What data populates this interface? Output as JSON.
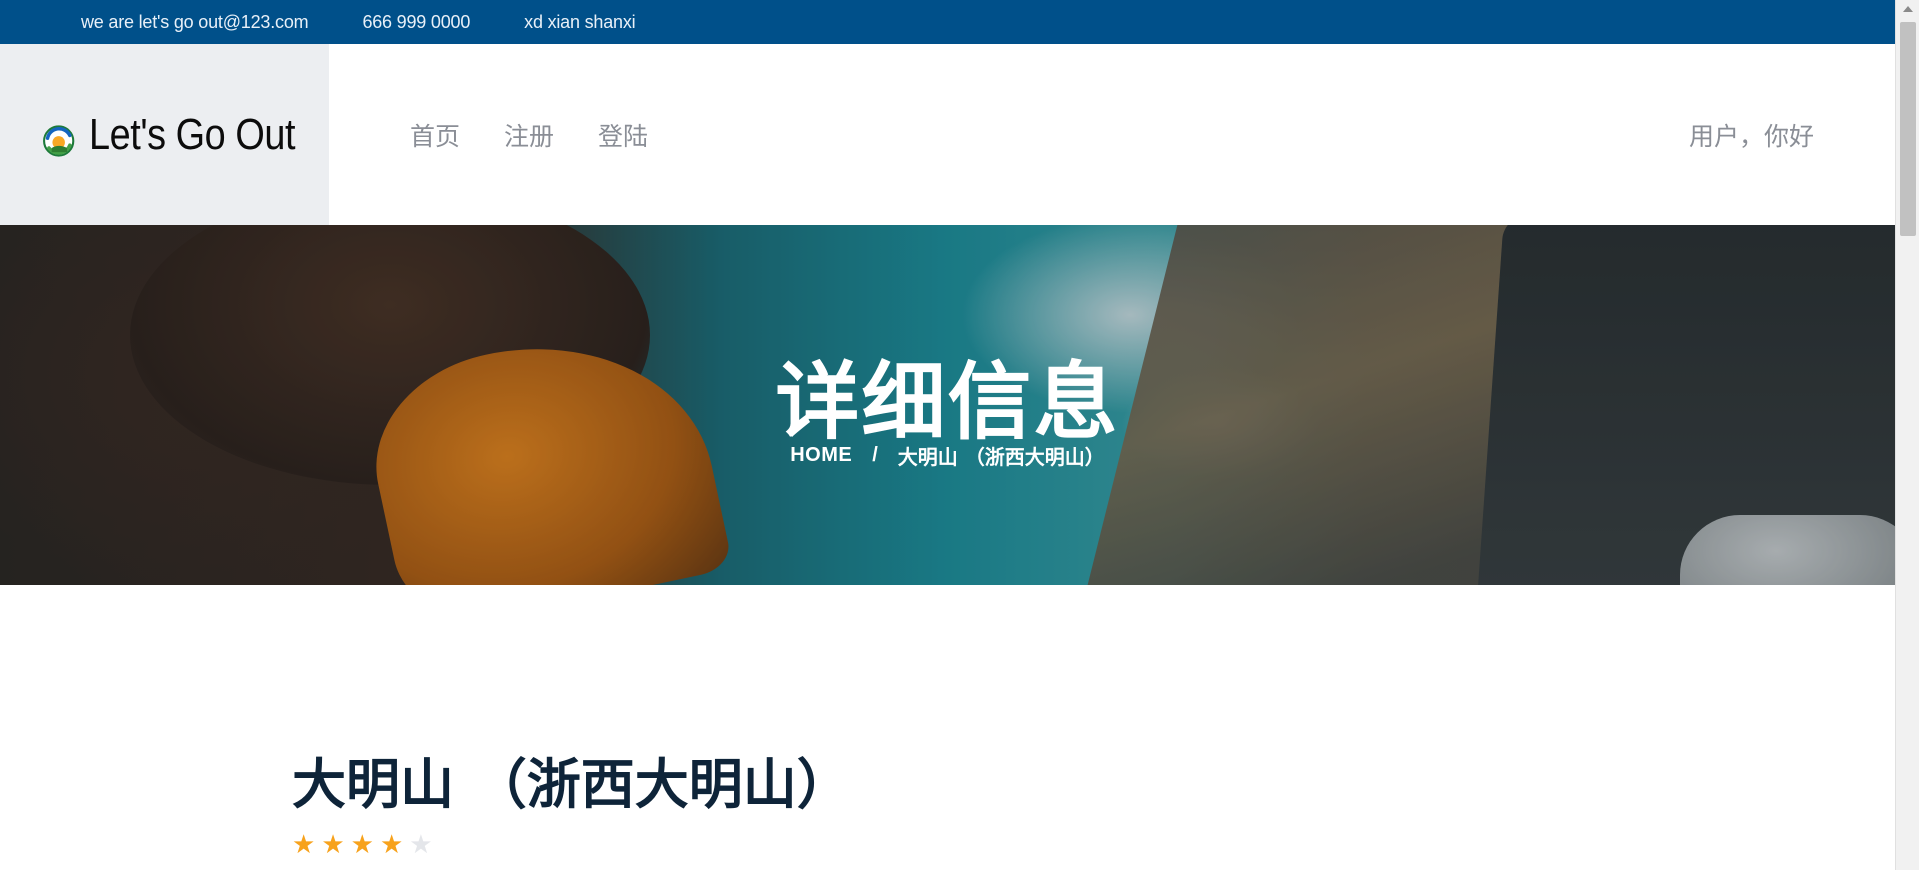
{
  "topbar": {
    "email": "we are let's go out@123.com",
    "phone": "666 999 0000",
    "address": "xd xian shanxi"
  },
  "header": {
    "brand": "Let's Go Out",
    "logo_icon": "globe-logo-icon",
    "nav": [
      {
        "label": "首页"
      },
      {
        "label": "注册"
      },
      {
        "label": "登陆"
      }
    ],
    "user_greeting": "用户，你好"
  },
  "hero": {
    "title": "详细信息",
    "breadcrumb_home": "HOME",
    "breadcrumb_separator": "/",
    "breadcrumb_current": "大明山 （浙西大明山）"
  },
  "detail": {
    "title": "大明山 （浙西大明山）",
    "rating": 4,
    "rating_max": 5
  },
  "colors": {
    "topbar": "#00508a",
    "logo_bg": "#eceef1",
    "nav_text": "#8a8e96",
    "title_text": "#0e2439",
    "star_on": "#f7a21c",
    "star_off": "#e4e6ea"
  }
}
